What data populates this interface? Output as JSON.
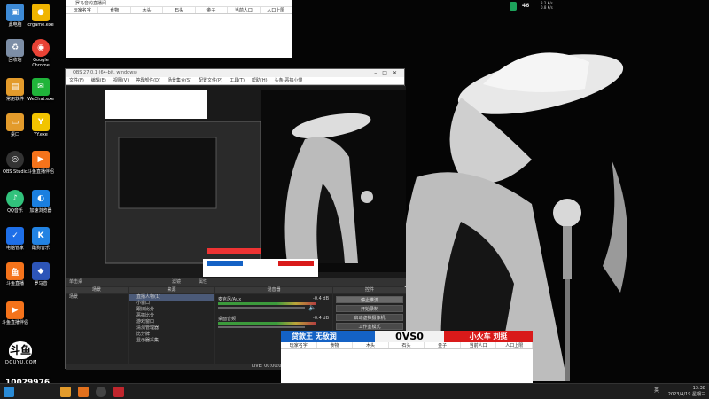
{
  "desktop_icons": [
    {
      "label": "此电脑",
      "color": "#3d8ad6"
    },
    {
      "label": "crgame.exe",
      "color": "#f0b400"
    },
    {
      "label": "回收站",
      "color": "#7d8ea6"
    },
    {
      "label": "Google Chrome",
      "color": "#e94235"
    },
    {
      "label": "常用软件",
      "color": "#e39b2b"
    },
    {
      "label": "WeChat.exe",
      "color": "#20b43a"
    },
    {
      "label": "桌口",
      "color": "#e39b2b"
    },
    {
      "label": "YY.exe",
      "color": "#f2c400"
    },
    {
      "label": "OBS Studio",
      "color": "#333"
    },
    {
      "label": "斗鱼直播伴侣",
      "color": "#f5731b"
    },
    {
      "label": "QQ音乐",
      "color": "#31c27c"
    },
    {
      "label": "加速浏览器",
      "color": "#1a7fe0"
    },
    {
      "label": "电脑管家",
      "color": "#1e6fe8"
    },
    {
      "label": "酷狗音乐",
      "color": "#2283e3"
    },
    {
      "label": "斗鱼直播",
      "color": "#f5731b"
    },
    {
      "label": "罗马音",
      "color": "#2d55b8"
    },
    {
      "label": "斗鱼直播伴侣",
      "color": "#f5731b"
    }
  ],
  "douyu_logo": {
    "title": "斗鱼",
    "sub": "DOUYU.COM"
  },
  "room_id": "10029976",
  "sheet_top": {
    "title": "罗马音的直播间",
    "headers": [
      "玩家名字",
      "食物",
      "木头",
      "石头",
      "金子",
      "当前人口",
      "人口上限"
    ]
  },
  "sheet_bottom": {
    "headers": [
      "玩家名字",
      "食物",
      "木头",
      "石头",
      "金子",
      "当前人口",
      "人口上限"
    ]
  },
  "obs": {
    "title": "OBS 27.0.1 (64-bit, windows)",
    "menus": [
      "文件(F)",
      "编辑(E)",
      "视图(V)",
      "停靠部件(D)",
      "场景集合(S)",
      "配置文件(P)",
      "工具(T)",
      "帮助(H)",
      "头条-恶搞小慢"
    ],
    "mode_label": "单击桌",
    "scenes_header": "场景",
    "scene_item": "场景",
    "sources_header": "来源",
    "sources": [
      "直播人物(1)",
      "小窗口",
      "跟旧比分",
      "恶搞比分",
      "游戏窗口",
      "清测管理器",
      "比分牌",
      "显示器采集"
    ],
    "mixer_header": "混音器",
    "mixer": [
      {
        "name": "麦克风/Aux",
        "db": "-0.4 dB"
      },
      {
        "name": "桌面音频",
        "db": "-0.4 dB"
      }
    ],
    "controls_header": "控件",
    "controls": [
      "停止推流",
      "开始录制",
      "启动虚拟摄像机",
      "工作室模式"
    ],
    "status": "LIVE: 00:00:00",
    "filter_label": "滤镜",
    "properties_label": "属性"
  },
  "scoreboard": {
    "left": "贷款王 无敌润",
    "middle": "0VS0",
    "right": "小火车 刘挺"
  },
  "tray": {
    "battery": "46",
    "speed_up": "3.2 K/s",
    "speed_down": "0.8 K/s",
    "time": "13:38",
    "date": "2023/4/19 星期三",
    "lang": "英"
  }
}
